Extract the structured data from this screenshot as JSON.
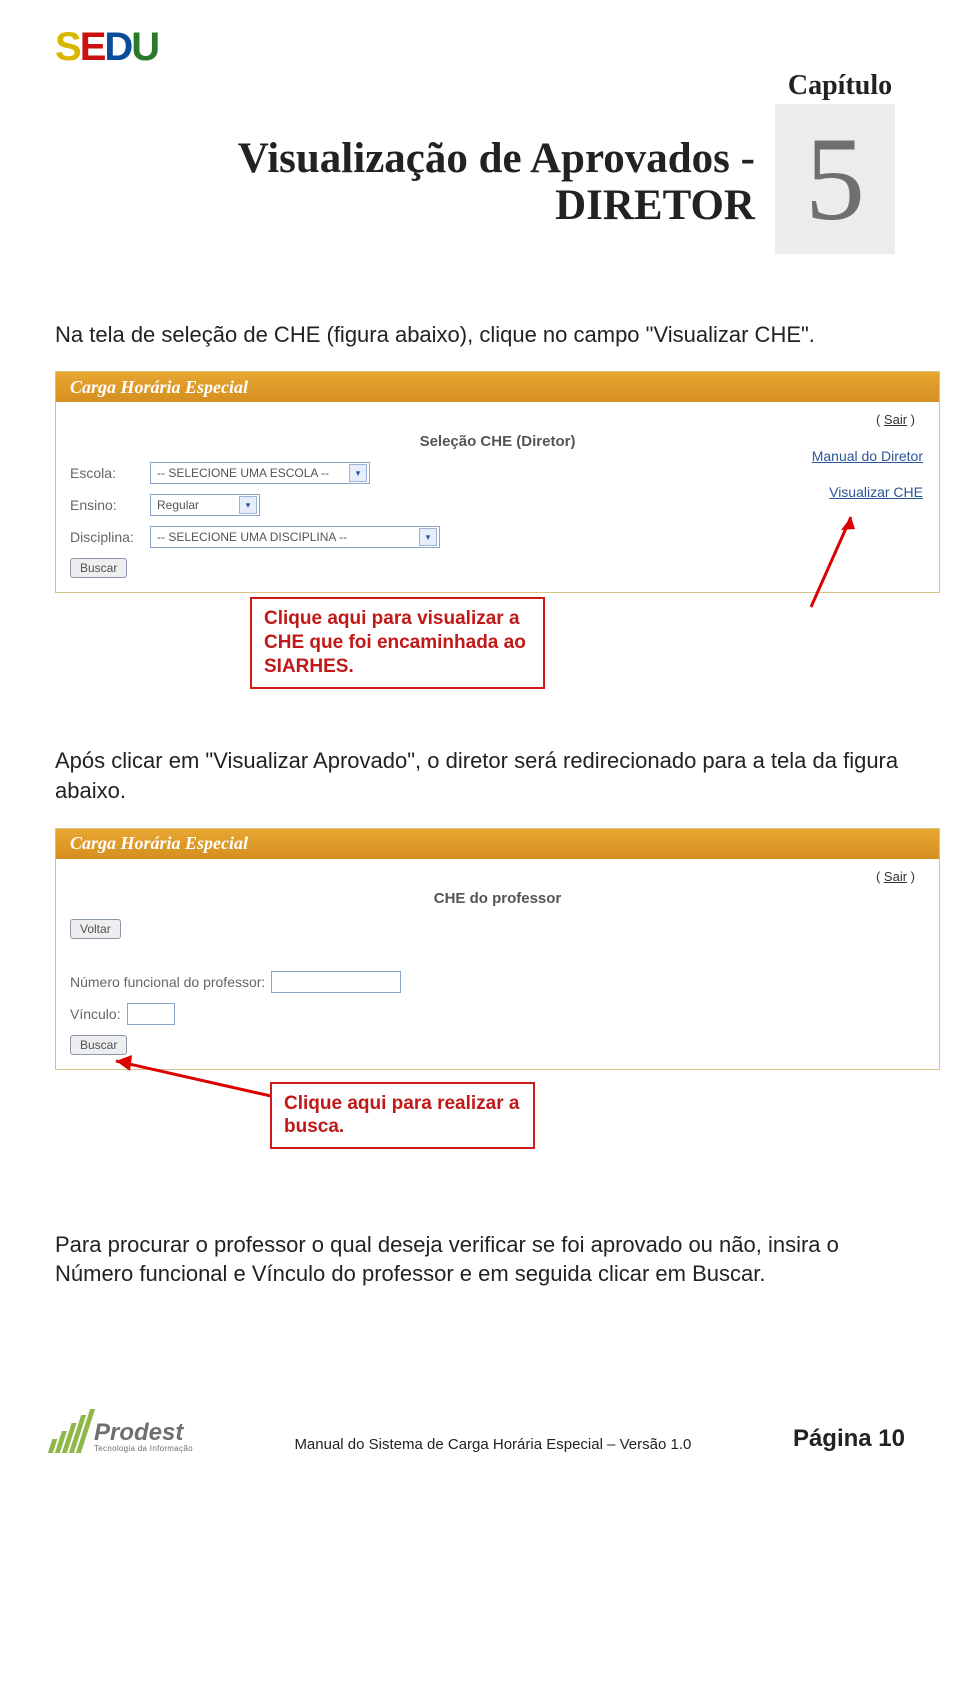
{
  "chapter": {
    "label": "Capítulo",
    "number": "5"
  },
  "title_line1": "Visualização de Aprovados -",
  "title_line2": "DIRETOR",
  "paragraph1": "Na tela de seleção de CHE (figura abaixo), clique no campo \"Visualizar CHE\".",
  "panel1": {
    "title": "Carga Horária Especial",
    "sair": "Sair",
    "form_title": "Seleção CHE (Diretor)",
    "labels": {
      "escola": "Escola:",
      "ensino": "Ensino:",
      "disciplina": "Disciplina:"
    },
    "escola_value": "-- SELECIONE UMA ESCOLA --",
    "ensino_value": "Regular",
    "disciplina_value": "-- SELECIONE UMA DISCIPLINA --",
    "buscar": "Buscar",
    "link_manual": "Manual do Diretor",
    "link_visualizar": "Visualizar CHE"
  },
  "callout1": "Clique aqui para visualizar a CHE que foi encaminhada ao SIARHES.",
  "paragraph2": "Após clicar em \"Visualizar Aprovado\", o diretor será redirecionado para a tela da figura abaixo.",
  "panel2": {
    "title": "Carga Horária Especial",
    "sair": "Sair",
    "form_title": "CHE do professor",
    "voltar": "Voltar",
    "label_numero": "Número funcional do professor:",
    "label_vinculo": "Vínculo:",
    "buscar": "Buscar"
  },
  "callout2": "Clique aqui para realizar a busca.",
  "paragraph3": "Para procurar o professor o qual deseja verificar se foi aprovado ou não, insira o Número funcional e Vínculo do professor e em seguida clicar em Buscar.",
  "footer": {
    "prodest": "Prodest",
    "prodest_sub": "Tecnologia da Informação",
    "manual": "Manual do Sistema de Carga Horária Especial – Versão 1.0",
    "page": "Página  10"
  }
}
